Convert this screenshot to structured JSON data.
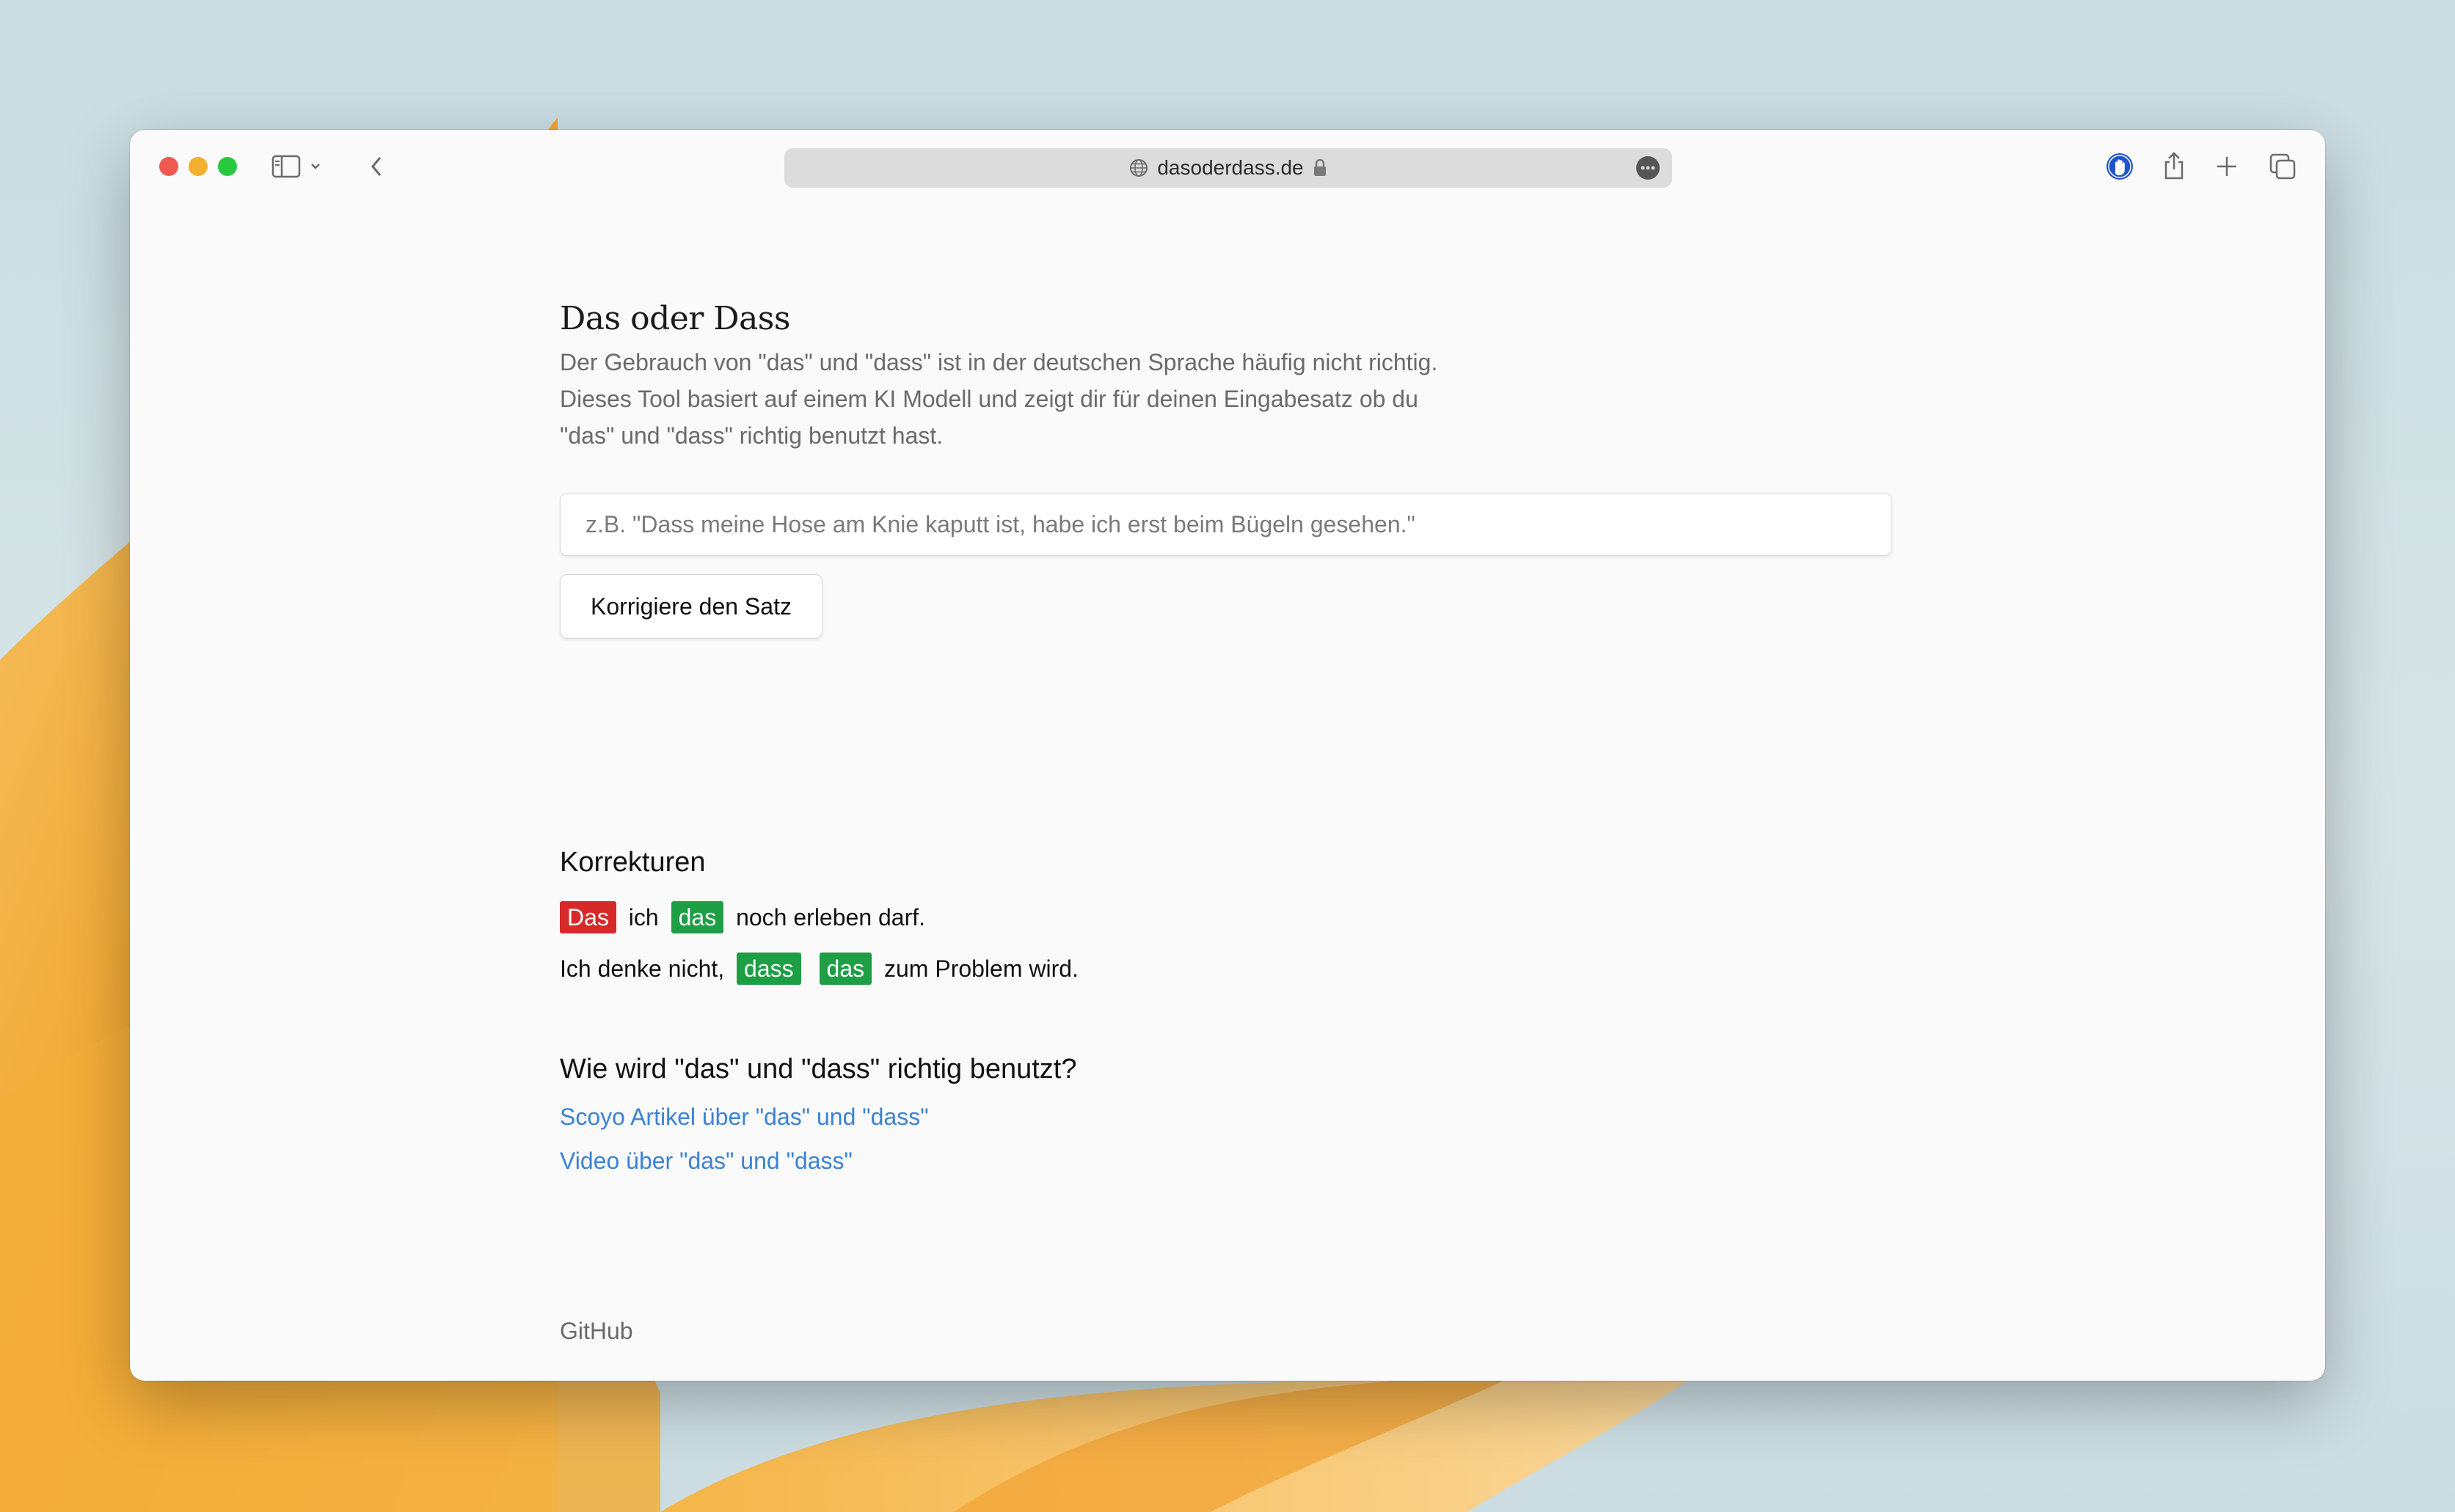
{
  "browser": {
    "url": "dasoderdass.de",
    "icons": {
      "sidebar": "sidebar-icon",
      "back": "chevron-left-icon",
      "site": "globe-icon",
      "secure": "lock-icon",
      "more": "ellipsis-icon",
      "extension": "hand-icon",
      "share": "share-icon",
      "new_tab": "plus-icon",
      "tabs": "tabs-overview-icon"
    },
    "traffic_light_colors": [
      "#ee5a52",
      "#f3b02f",
      "#28c83f"
    ]
  },
  "page": {
    "title": "Das oder Dass",
    "description": [
      "Der Gebrauch von \"das\" und \"dass\" ist in der deutschen Sprache häufig nicht richtig.",
      "Dieses Tool basiert auf einem KI Modell und zeigt dir für deinen Eingabesatz ob du",
      "\"das\" und \"dass\" richtig benutzt hast."
    ],
    "input": {
      "placeholder": "z.B. \"Dass meine Hose am Knie kaputt ist, habe ich erst beim Bügeln gesehen.\"",
      "value": ""
    },
    "button_label": "Korrigiere den Satz",
    "corrections": {
      "heading": "Korrekturen",
      "sentences": [
        [
          {
            "text": "Das",
            "status": "wrong"
          },
          {
            "text": " ich ",
            "status": "plain"
          },
          {
            "text": "das",
            "status": "correct"
          },
          {
            "text": " noch erleben darf.",
            "status": "plain"
          }
        ],
        [
          {
            "text": "Ich denke nicht, ",
            "status": "plain"
          },
          {
            "text": "dass",
            "status": "correct"
          },
          {
            "text": " ",
            "status": "plain"
          },
          {
            "text": "das",
            "status": "correct"
          },
          {
            "text": " zum Problem wird.",
            "status": "plain"
          }
        ]
      ],
      "colors": {
        "wrong": "#d62a2a",
        "correct": "#1e9e45"
      }
    },
    "help": {
      "heading": "Wie wird \"das\" und \"dass\" richtig benutzt?",
      "links": [
        "Scoyo Artikel über \"das\" und \"dass\"",
        "Video über \"das\" und \"dass\""
      ]
    },
    "footer_link": "GitHub"
  }
}
